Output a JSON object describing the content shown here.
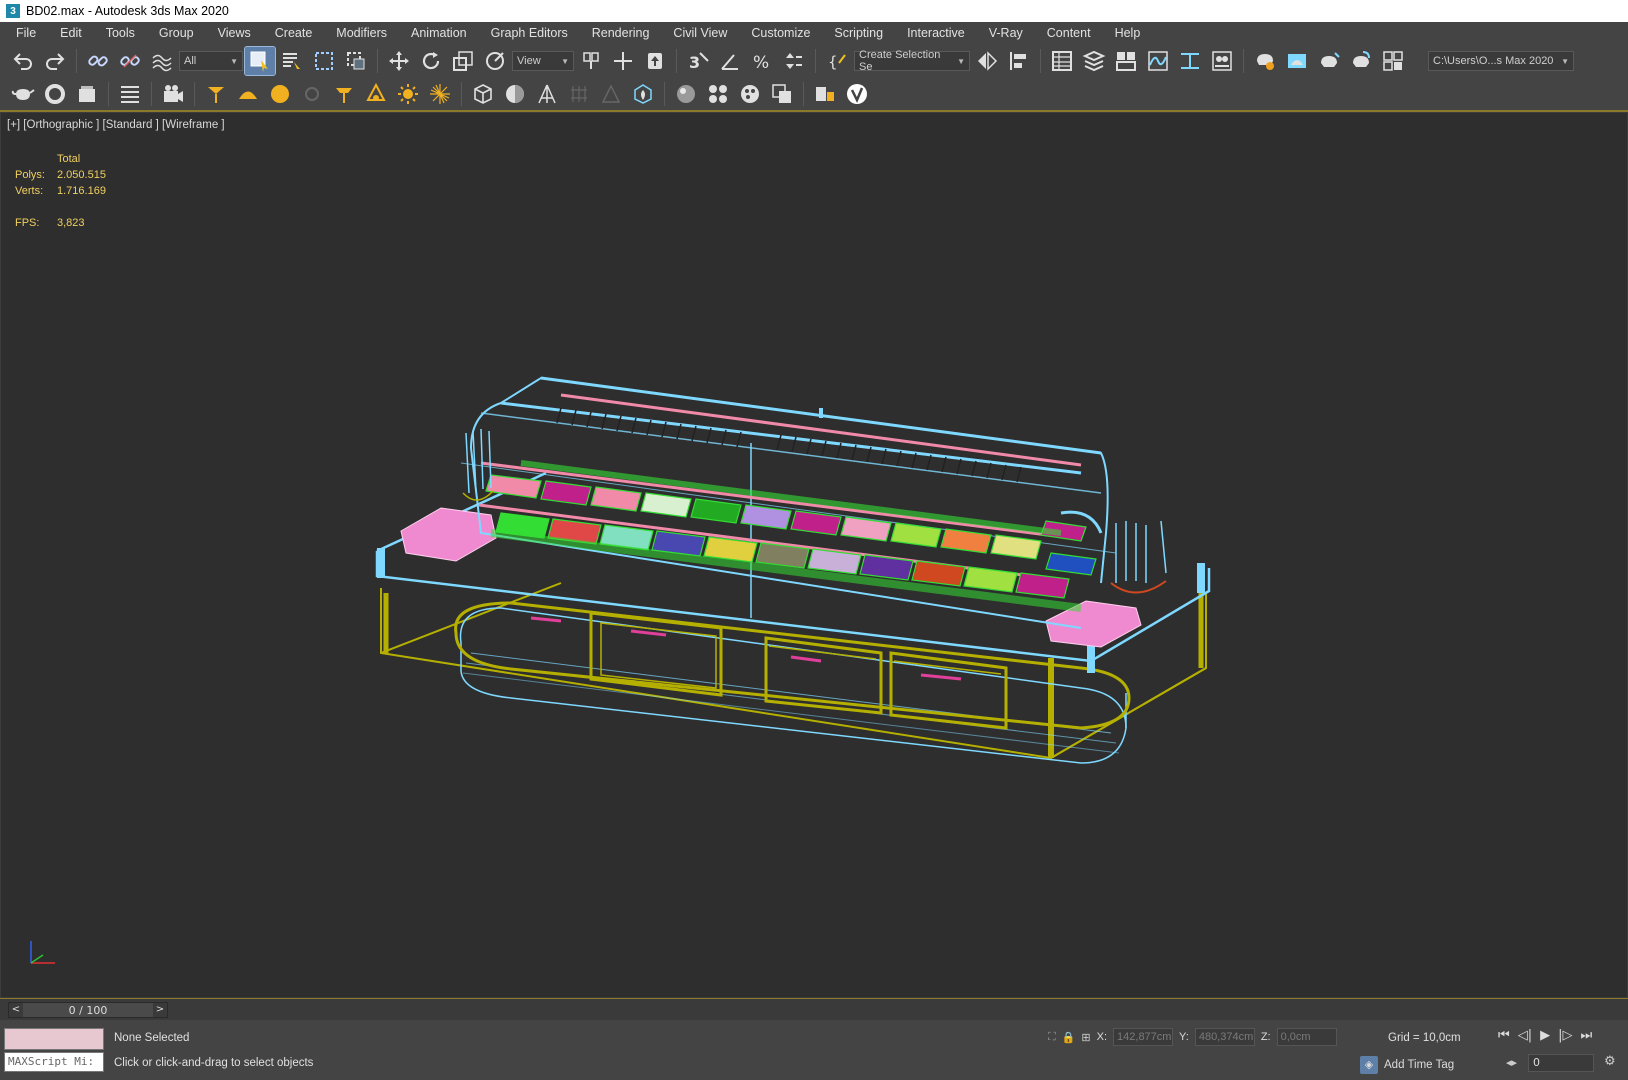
{
  "window": {
    "title": "BD02.max - Autodesk 3ds Max 2020",
    "app_icon": "3"
  },
  "menu": [
    "File",
    "Edit",
    "Tools",
    "Group",
    "Views",
    "Create",
    "Modifiers",
    "Animation",
    "Graph Editors",
    "Rendering",
    "Civil View",
    "Customize",
    "Scripting",
    "Interactive",
    "V-Ray",
    "Content",
    "Help"
  ],
  "toolbar": {
    "selection_filter": "All",
    "ref_coord": "View",
    "named_selection": "Create Selection Se",
    "project_path": "C:\\Users\\O...s Max 2020"
  },
  "viewport": {
    "label": "[+] [Orthographic ] [Standard ] [Wireframe ]",
    "stats": {
      "total_label": "Total",
      "polys_label": "Polys:",
      "polys_value": "2.050.515",
      "verts_label": "Verts:",
      "verts_value": "1.716.169",
      "fps_label": "FPS:",
      "fps_value": "3,823"
    }
  },
  "timeline": {
    "frame_display": "0 / 100",
    "prev": "<",
    "next": ">"
  },
  "status": {
    "selection": "None Selected",
    "prompt": "Click or click-and-drag to select objects",
    "maxscript_placeholder": "MAXScript Mi:",
    "x_label": "X:",
    "x_value": "142,877cm",
    "y_label": "Y:",
    "y_value": "480,374cm",
    "z_label": "Z:",
    "z_value": "0,0cm",
    "grid": "Grid = 10,0cm",
    "add_time_tag": "Add Time Tag",
    "current_frame": "0"
  },
  "colors": {
    "wire_cyan": "#7fd8ff",
    "wire_olive": "#b5b000",
    "wire_green": "#33dd33",
    "wire_pink": "#f08aa8",
    "stats_yellow": "#f0d060",
    "accent_gold": "#8a7a2a"
  }
}
